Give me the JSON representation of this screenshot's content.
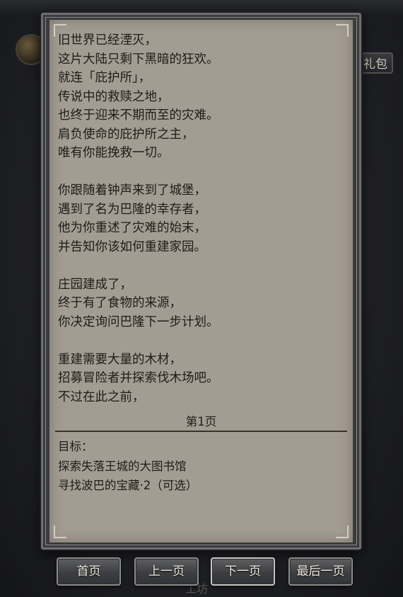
{
  "story": {
    "lines": [
      "旧世界已经湮灭，",
      "这片大陆只剩下黑暗的狂欢。",
      "就连「庇护所」，",
      "传说中的救赎之地，",
      "也终于迎来不期而至的灾难。",
      "肩负使命的庇护所之主，",
      "唯有你能挽救一切。",
      "",
      "你跟随着钟声来到了城堡，",
      "遇到了名为巴隆的幸存者，",
      "他为你重述了灾难的始末，",
      "并告知你该如何重建家园。",
      "",
      "庄园建成了，",
      "终于有了食物的来源，",
      "你决定询问巴隆下一步计划。",
      "",
      "重建需要大量的木材，",
      "招募冒险者并探索伐木场吧。",
      "不过在此之前，"
    ]
  },
  "page_label": "第1页",
  "goals": {
    "title": "目标：",
    "items": [
      "探索失落王城的大图书馆",
      "寻找波巴的宝藏·2（可选）"
    ]
  },
  "nav": {
    "first": "首页",
    "prev": "上一页",
    "next": "下一页",
    "last": "最后一页"
  },
  "background": {
    "gift_label": "礼包",
    "bottom_label": "工坊"
  }
}
